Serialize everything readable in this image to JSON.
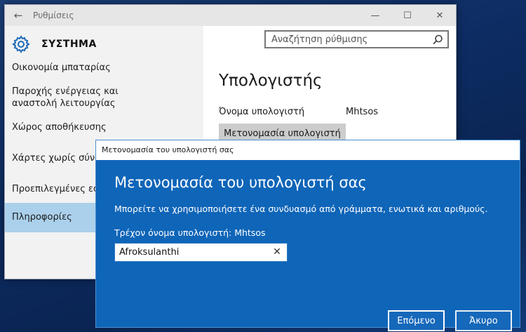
{
  "settings_window": {
    "title": "Ρυθμίσεις",
    "back_icon": "back-arrow-icon",
    "controls": [
      "minimize-icon",
      "maximize-icon",
      "close-icon"
    ]
  },
  "app": {
    "title": "ΣΥΣΤΗΜΑ",
    "icon": "gear-icon"
  },
  "search": {
    "placeholder": "Αναζήτηση ρύθμισης",
    "icon": "search-icon"
  },
  "nav": {
    "items": [
      {
        "label": "Οικονομία μπαταρίας",
        "selected": false
      },
      {
        "label": "Παροχής ενέργειας και αναστολή λειτουργίας",
        "selected": false
      },
      {
        "label": "Χώρος αποθήκευσης",
        "selected": false
      },
      {
        "label": "Χάρτες χωρίς σύνδε",
        "selected": false
      },
      {
        "label": "Προεπιλεγμένες εφα",
        "selected": false
      },
      {
        "label": "Πληροφορίες",
        "selected": true
      }
    ]
  },
  "main": {
    "section_title": "Υπολογιστής",
    "pc_name_label": "Όνομα υπολογιστή",
    "pc_name_value": "Mhtsos",
    "rename_button": "Μετονομασία υπολογιστή"
  },
  "dialog": {
    "titlebar": "Μετονομασία του υπολογιστή σας",
    "heading": "Μετονομασία του υπολογιστή σας",
    "description": "Μπορείτε να χρησιμοποιήσετε ένα συνδυασμό από γράμματα, ενωτικά και αριθμούς.",
    "current_name": "Τρέχον όνομα υπολογιστή: Mhtsos",
    "input_value": "Afroksulanthi",
    "clear_icon": "clear-x-icon",
    "next_button": "Επόμενο",
    "cancel_button": "Άκυρο"
  },
  "colors": {
    "dialog_bg": "#0f65b8",
    "selected_nav": "#aad0ec",
    "left_pane": "#f2f2f2"
  }
}
